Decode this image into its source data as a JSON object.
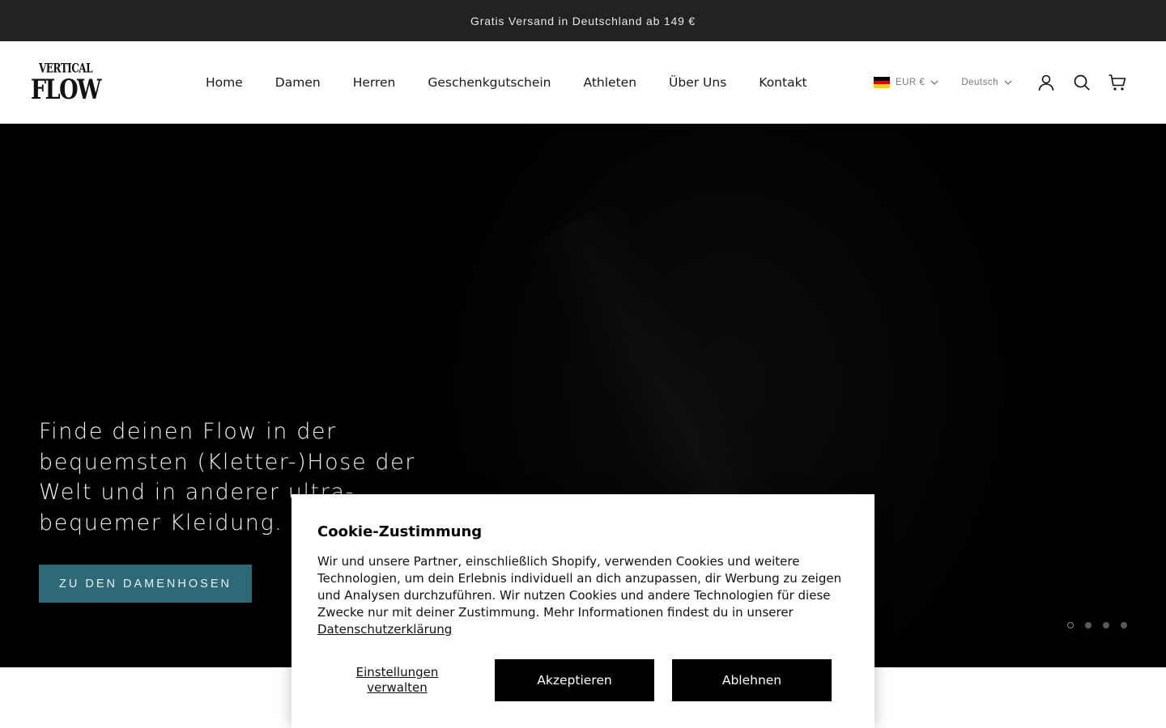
{
  "announcement": {
    "text": "Gratis Versand in Deutschland ab 149 €"
  },
  "header": {
    "logo": {
      "top": "VERTICAL",
      "bottom": "FLOW"
    },
    "nav": [
      {
        "label": "Home"
      },
      {
        "label": "Damen"
      },
      {
        "label": "Herren"
      },
      {
        "label": "Geschenkgutschein"
      },
      {
        "label": "Athleten"
      },
      {
        "label": "Über Uns"
      },
      {
        "label": "Kontakt"
      }
    ],
    "currency": {
      "value": "EUR €",
      "flag_colors": [
        "#000000",
        "#dd0000",
        "#ffce00"
      ]
    },
    "language": {
      "value": "Deutsch"
    },
    "icons": [
      "account-icon",
      "search-icon",
      "cart-icon"
    ]
  },
  "hero": {
    "headline": "Finde deinen Flow in der bequemsten (Kletter-)Hose der Welt und in anderer ultra-bequemer Kleidung.",
    "cta_label": "ZU DEN DAMENHOSEN",
    "cta_color": "#2c6a78",
    "slides_total": 4,
    "slide_active": 1
  },
  "cookie": {
    "title": "Cookie-Zustimmung",
    "text": "Wir und unsere Partner, einschließlich Shopify, verwenden Cookies und weitere Technologien, um dein Erlebnis individuell an dich anzupassen, dir Werbung zu zeigen und Analysen durchzuführen. Wir nutzen Cookies und andere Technologien für diese Zwecke nur mit deiner Zustimmung. Mehr Informationen findest du in unserer",
    "link_label": "Datenschutzerklärung",
    "manage_label": "Einstellungen verwalten",
    "accept_label": "Akzeptieren",
    "decline_label": "Ablehnen"
  }
}
